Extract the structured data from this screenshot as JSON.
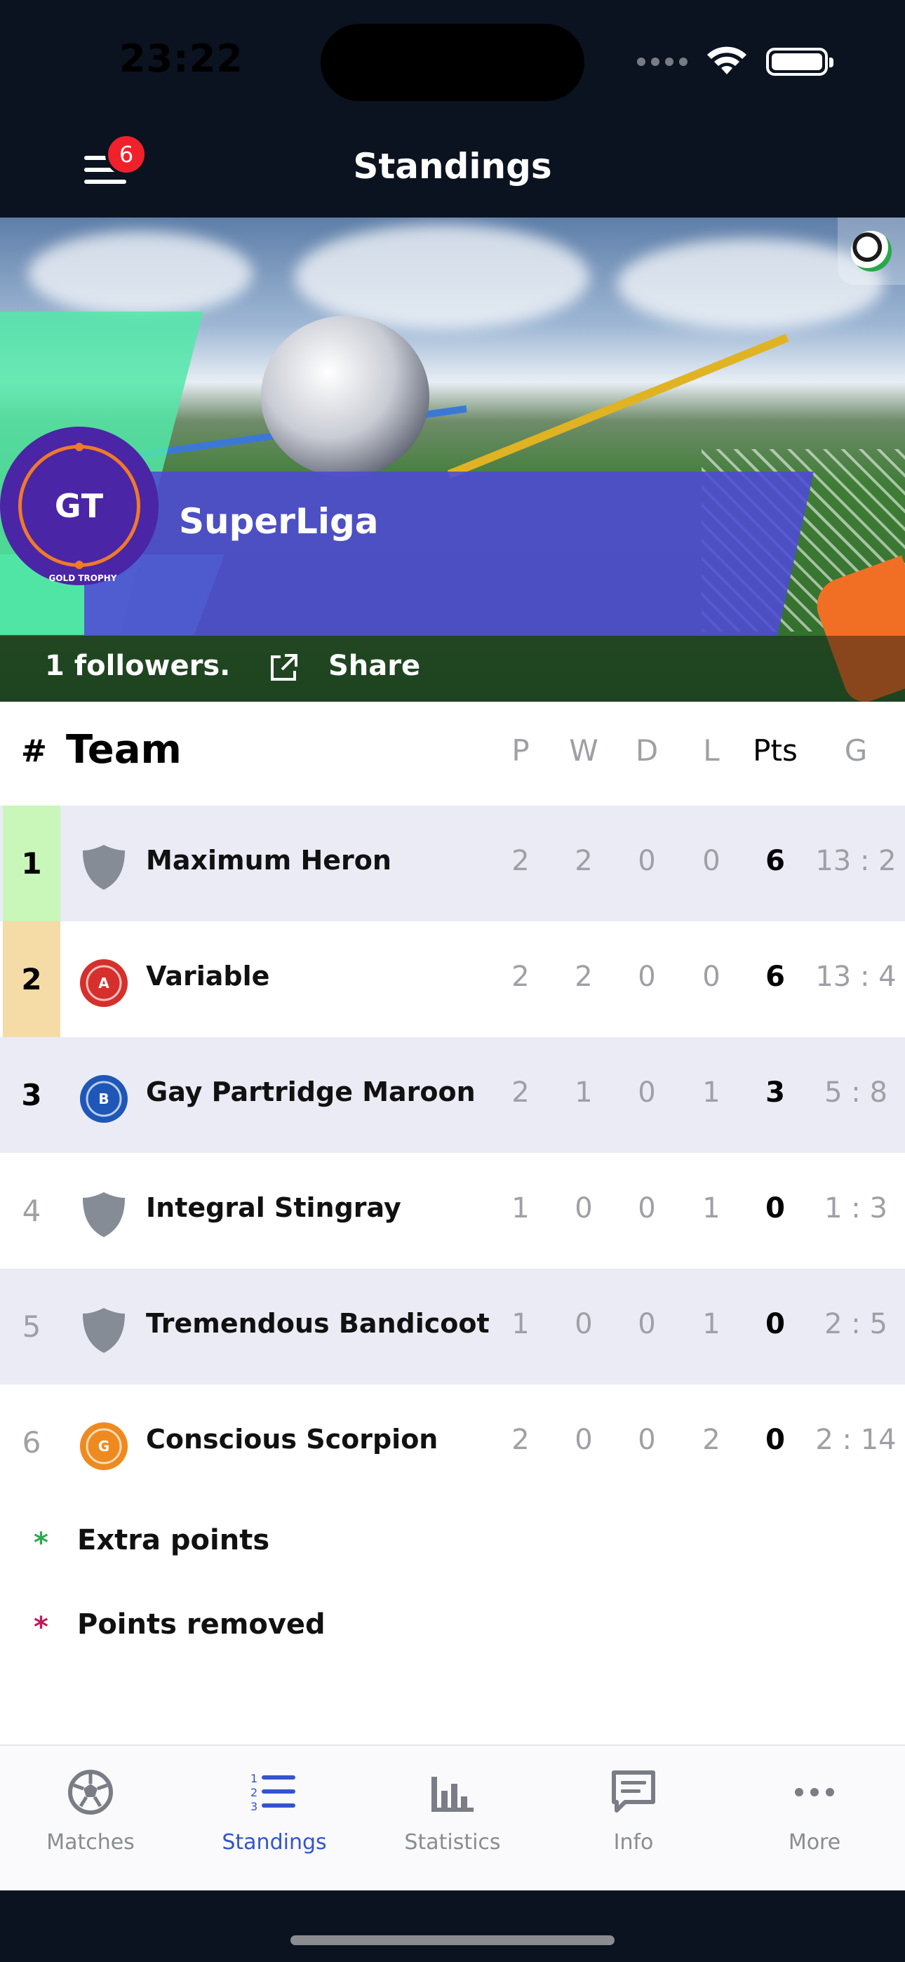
{
  "status_bar": {
    "time": "23:22"
  },
  "nav": {
    "title": "Standings",
    "menu_badge": "6"
  },
  "league": {
    "logo_initials": "GT",
    "logo_caption": "GOLD TROPHY",
    "name": "SuperLiga",
    "followers": "1 followers.",
    "share_label": "Share"
  },
  "table": {
    "headers": {
      "pos": "#",
      "team": "Team",
      "p": "P",
      "w": "W",
      "d": "D",
      "l": "L",
      "pts": "Pts",
      "g": "G"
    },
    "rows": [
      {
        "pos": "1",
        "team": "Maximum Heron",
        "p": "2",
        "w": "2",
        "d": "0",
        "l": "0",
        "pts": "6",
        "g": "13 : 2",
        "zone_color": "#c9f6b9",
        "crest": "shield-icon",
        "crest_color": "#858c96"
      },
      {
        "pos": "2",
        "team": "Variable",
        "p": "2",
        "w": "2",
        "d": "0",
        "l": "0",
        "pts": "6",
        "g": "13 : 4",
        "zone_color": "#f5dba6",
        "crest": "badge-a-icon",
        "crest_color": "#d5302c",
        "crest_letter": "A"
      },
      {
        "pos": "3",
        "team": "Gay Partridge Maroon",
        "p": "2",
        "w": "1",
        "d": "0",
        "l": "1",
        "pts": "3",
        "g": "5 : 8",
        "zone_color": "",
        "crest": "badge-b-icon",
        "crest_color": "#1e57b8",
        "crest_letter": "B"
      },
      {
        "pos": "4",
        "team": "Integral Stingray",
        "p": "1",
        "w": "0",
        "d": "0",
        "l": "1",
        "pts": "0",
        "g": "1 : 3",
        "zone_color": "",
        "crest": "shield-icon",
        "crest_color": "#858c96"
      },
      {
        "pos": "5",
        "team": "Tremendous Bandicoot",
        "p": "1",
        "w": "0",
        "d": "0",
        "l": "1",
        "pts": "0",
        "g": "2 : 5",
        "zone_color": "",
        "crest": "shield-icon",
        "crest_color": "#858c96"
      },
      {
        "pos": "6",
        "team": "Conscious Scorpion",
        "p": "2",
        "w": "0",
        "d": "0",
        "l": "2",
        "pts": "0",
        "g": "2 : 14",
        "zone_color": "",
        "crest": "badge-g-icon",
        "crest_color": "#ef8a1e",
        "crest_letter": "G"
      }
    ]
  },
  "legend": [
    {
      "symbol": "*",
      "label": "Extra points",
      "color": "#2fa84f"
    },
    {
      "symbol": "*",
      "label": "Points removed",
      "color": "#c2185b"
    }
  ],
  "tabs": [
    {
      "label": "Matches",
      "icon": "soccer-ball-icon",
      "active": false
    },
    {
      "label": "Standings",
      "icon": "list-numbered-icon",
      "active": true
    },
    {
      "label": "Statistics",
      "icon": "bar-chart-icon",
      "active": false
    },
    {
      "label": "Info",
      "icon": "chat-icon",
      "active": false
    },
    {
      "label": "More",
      "icon": "more-dots-icon",
      "active": false
    }
  ],
  "colors": {
    "accent": "#3355cc",
    "dark": "#0b1320",
    "row_alt": "#ebebf5"
  }
}
